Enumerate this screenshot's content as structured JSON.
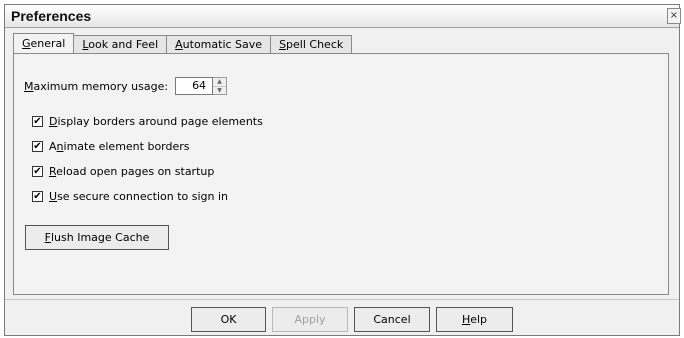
{
  "window": {
    "title": "Preferences",
    "close_glyph": "×"
  },
  "tabs": [
    {
      "mnemonic": "G",
      "rest": "eneral",
      "active": true
    },
    {
      "mnemonic": "L",
      "rest": "ook and Feel",
      "active": false
    },
    {
      "mnemonic": "A",
      "rest": "utomatic Save",
      "active": false
    },
    {
      "mnemonic": "S",
      "rest": "pell Check",
      "active": false
    }
  ],
  "general": {
    "memory_label_mn": "M",
    "memory_label_rest": "aximum memory usage:",
    "memory_value": "64",
    "checkboxes": [
      {
        "mn": "D",
        "rest": "isplay borders around page elements",
        "checked": true
      },
      {
        "pre": "A",
        "mn": "n",
        "rest": "imate element borders",
        "checked": true
      },
      {
        "mn": "R",
        "rest": "eload open pages on startup",
        "checked": true
      },
      {
        "mn": "U",
        "rest": "se secure connection to sign in",
        "checked": true
      }
    ],
    "check_mark": "✔",
    "flush_mn": "F",
    "flush_rest": "lush Image Cache"
  },
  "footer": {
    "ok": "OK",
    "apply": "Apply",
    "cancel": "Cancel",
    "help_mn": "H",
    "help_rest": "elp"
  }
}
